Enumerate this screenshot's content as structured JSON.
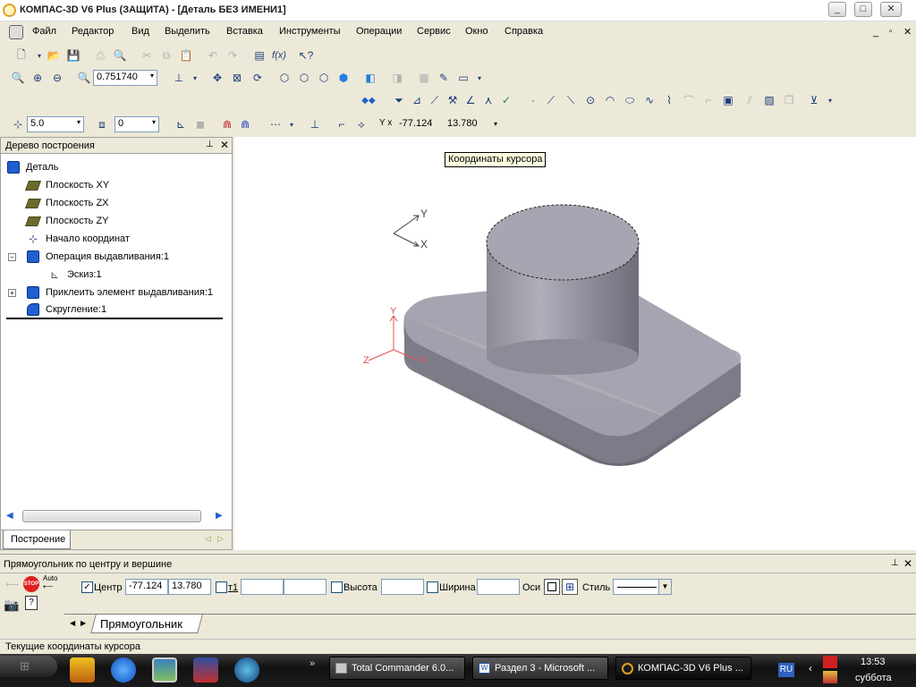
{
  "window": {
    "title": "КОМПАС-3D V6 Plus (ЗАЩИТА) - [Деталь БЕЗ ИМЕНИ1]"
  },
  "menu": {
    "items": [
      "Файл",
      "Редактор",
      "Вид",
      "Выделить",
      "Вставка",
      "Инструменты",
      "Операции",
      "Сервис",
      "Окно",
      "Справка"
    ]
  },
  "toolbar": {
    "zoom_value": "0.751740",
    "step_value": "5.0",
    "layer_value": "0",
    "coord_x": "-77.124",
    "coord_y": "13.780"
  },
  "tree": {
    "header": "Дерево построения",
    "items": [
      {
        "label": "Деталь"
      },
      {
        "label": "Плоскость XY"
      },
      {
        "label": "Плоскость ZX"
      },
      {
        "label": "Плоскость ZY"
      },
      {
        "label": "Начало координат"
      },
      {
        "label": "Операция выдавливания:1"
      },
      {
        "label": "Эскиз:1"
      },
      {
        "label": "Приклеить элемент выдавливания:1"
      },
      {
        "label": "Скругление:1"
      }
    ],
    "tab": "Построение"
  },
  "viewport": {
    "tooltip": "Координаты курсора",
    "axis_labels": {
      "x": "X",
      "y": "Y",
      "z": "Z"
    }
  },
  "properties": {
    "title": "Прямоугольник по центру и вершине",
    "center_label": "Центр",
    "center_x": "-77.124",
    "center_y": "13.780",
    "t1_label": "т1",
    "height_label": "Высота",
    "width_label": "Ширина",
    "axes_label": "Оси",
    "style_label": "Стиль",
    "tab": "Прямоугольник",
    "stop_label": "STOP",
    "auto_label": "Auto"
  },
  "status": {
    "text": "Текущие координаты курсора"
  },
  "taskbar": {
    "apps": [
      {
        "label": "Total Commander 6.0..."
      },
      {
        "label": "Раздел 3 - Microsoft ..."
      },
      {
        "label": "КОМПАС-3D V6 Plus ..."
      }
    ],
    "lang": "RU",
    "time": "13:53",
    "day": "суббота"
  }
}
